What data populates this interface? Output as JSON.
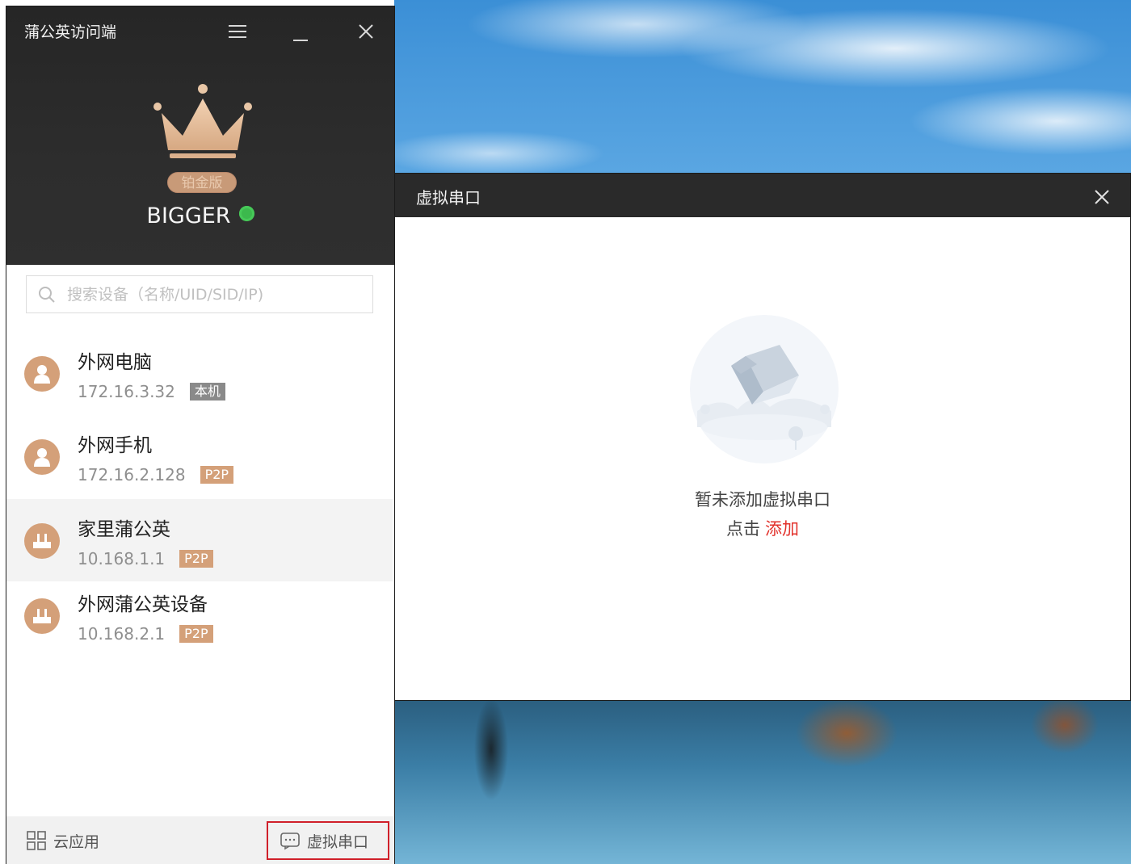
{
  "app": {
    "title": "蒲公英访问端",
    "edition": "铂金版",
    "username": "BIGGER",
    "status_color": "#3cb94d"
  },
  "search": {
    "placeholder": "搜索设备（名称/UID/SID/IP)",
    "value": ""
  },
  "devices": [
    {
      "name": "外网电脑",
      "ip": "172.16.3.32",
      "tag": "本机",
      "icon": "user-icon"
    },
    {
      "name": "外网手机",
      "ip": "172.16.2.128",
      "tag": "P2P",
      "icon": "user-icon"
    },
    {
      "name": "家里蒲公英",
      "ip": "10.168.1.1",
      "tag": "P2P",
      "icon": "router-icon",
      "selected": true
    },
    {
      "name": "外网蒲公英设备",
      "ip": "10.168.2.1",
      "tag": "P2P",
      "icon": "router-icon"
    }
  ],
  "footer": {
    "cloud_apps": "云应用",
    "virtual_serial": "虚拟串口"
  },
  "dialog": {
    "title": "虚拟串口",
    "empty_text": "暂未添加虚拟串口",
    "action_prefix": "点击",
    "action_link": "添加",
    "link_color": "#e2312b"
  },
  "colors": {
    "accent": "#d4a079",
    "header_bg": "#2a2a2a"
  }
}
